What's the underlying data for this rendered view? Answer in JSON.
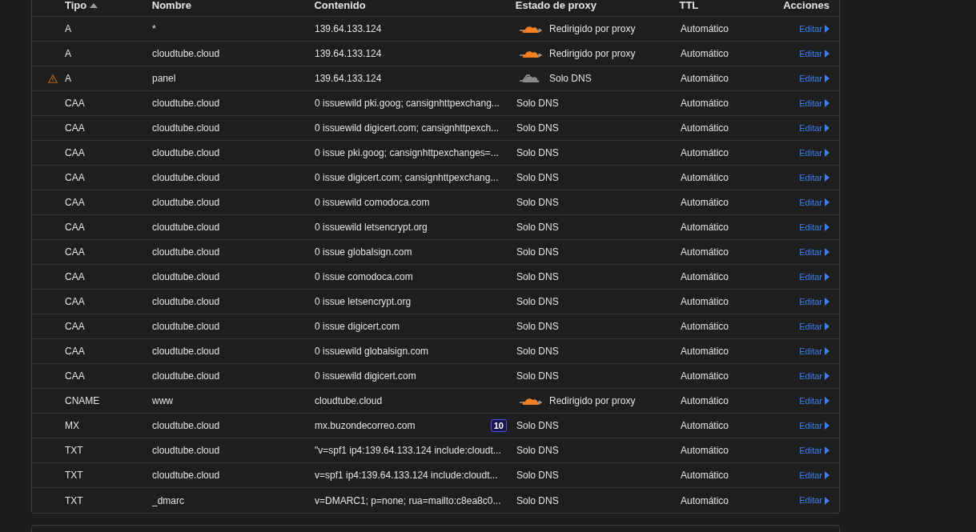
{
  "table": {
    "columns": [
      {
        "label": "Tipo",
        "sorted": true
      },
      {
        "label": "Nombre",
        "sorted": false
      },
      {
        "label": "Contenido",
        "sorted": false
      },
      {
        "label": "Estado de proxy",
        "sorted": false
      },
      {
        "label": "TTL",
        "sorted": false
      },
      {
        "label": "Acciones",
        "sorted": false
      }
    ],
    "rows": [
      {
        "warning": false,
        "type": "A",
        "name": "*",
        "content": "139.64.133.124",
        "proxy": {
          "kind": "proxied",
          "label": "Redirigido por proxy"
        },
        "ttl": "Automático",
        "action": "Editar"
      },
      {
        "warning": false,
        "type": "A",
        "name": "cloudtube.cloud",
        "content": "139.64.133.124",
        "proxy": {
          "kind": "proxied",
          "label": "Redirigido por proxy"
        },
        "ttl": "Automático",
        "action": "Editar"
      },
      {
        "warning": true,
        "type": "A",
        "name": "panel",
        "content": "139.64.133.124",
        "proxy": {
          "kind": "dns_only_icon",
          "label": "Solo DNS"
        },
        "ttl": "Automático",
        "action": "Editar"
      },
      {
        "warning": false,
        "type": "CAA",
        "name": "cloudtube.cloud",
        "content": "0 issuewild pki.goog; cansignhttpexchang...",
        "proxy": {
          "kind": "dns_only",
          "label": "Solo DNS"
        },
        "ttl": "Automático",
        "action": "Editar"
      },
      {
        "warning": false,
        "type": "CAA",
        "name": "cloudtube.cloud",
        "content": "0 issuewild digicert.com; cansignhttpexch...",
        "proxy": {
          "kind": "dns_only",
          "label": "Solo DNS"
        },
        "ttl": "Automático",
        "action": "Editar"
      },
      {
        "warning": false,
        "type": "CAA",
        "name": "cloudtube.cloud",
        "content": "0 issue pki.goog; cansignhttpexchanges=...",
        "proxy": {
          "kind": "dns_only",
          "label": "Solo DNS"
        },
        "ttl": "Automático",
        "action": "Editar"
      },
      {
        "warning": false,
        "type": "CAA",
        "name": "cloudtube.cloud",
        "content": "0 issue digicert.com; cansignhttpexchang...",
        "proxy": {
          "kind": "dns_only",
          "label": "Solo DNS"
        },
        "ttl": "Automático",
        "action": "Editar"
      },
      {
        "warning": false,
        "type": "CAA",
        "name": "cloudtube.cloud",
        "content": "0 issuewild comodoca.com",
        "proxy": {
          "kind": "dns_only",
          "label": "Solo DNS"
        },
        "ttl": "Automático",
        "action": "Editar"
      },
      {
        "warning": false,
        "type": "CAA",
        "name": "cloudtube.cloud",
        "content": "0 issuewild letsencrypt.org",
        "proxy": {
          "kind": "dns_only",
          "label": "Solo DNS"
        },
        "ttl": "Automático",
        "action": "Editar"
      },
      {
        "warning": false,
        "type": "CAA",
        "name": "cloudtube.cloud",
        "content": "0 issue globalsign.com",
        "proxy": {
          "kind": "dns_only",
          "label": "Solo DNS"
        },
        "ttl": "Automático",
        "action": "Editar"
      },
      {
        "warning": false,
        "type": "CAA",
        "name": "cloudtube.cloud",
        "content": "0 issue comodoca.com",
        "proxy": {
          "kind": "dns_only",
          "label": "Solo DNS"
        },
        "ttl": "Automático",
        "action": "Editar"
      },
      {
        "warning": false,
        "type": "CAA",
        "name": "cloudtube.cloud",
        "content": "0 issue letsencrypt.org",
        "proxy": {
          "kind": "dns_only",
          "label": "Solo DNS"
        },
        "ttl": "Automático",
        "action": "Editar"
      },
      {
        "warning": false,
        "type": "CAA",
        "name": "cloudtube.cloud",
        "content": "0 issue digicert.com",
        "proxy": {
          "kind": "dns_only",
          "label": "Solo DNS"
        },
        "ttl": "Automático",
        "action": "Editar"
      },
      {
        "warning": false,
        "type": "CAA",
        "name": "cloudtube.cloud",
        "content": "0 issuewild globalsign.com",
        "proxy": {
          "kind": "dns_only",
          "label": "Solo DNS"
        },
        "ttl": "Automático",
        "action": "Editar"
      },
      {
        "warning": false,
        "type": "CAA",
        "name": "cloudtube.cloud",
        "content": "0 issuewild digicert.com",
        "proxy": {
          "kind": "dns_only",
          "label": "Solo DNS"
        },
        "ttl": "Automático",
        "action": "Editar"
      },
      {
        "warning": false,
        "type": "CNAME",
        "name": "www",
        "content": "cloudtube.cloud",
        "proxy": {
          "kind": "proxied",
          "label": "Redirigido por proxy"
        },
        "ttl": "Automático",
        "action": "Editar"
      },
      {
        "warning": false,
        "type": "MX",
        "name": "cloudtube.cloud",
        "content": "mx.buzondecorreo.com",
        "priority": "10",
        "proxy": {
          "kind": "dns_only",
          "label": "Solo DNS"
        },
        "ttl": "Automático",
        "action": "Editar"
      },
      {
        "warning": false,
        "type": "TXT",
        "name": "cloudtube.cloud",
        "content": "\"v=spf1 ip4:139.64.133.124 include:cloudt...",
        "proxy": {
          "kind": "dns_only",
          "label": "Solo DNS"
        },
        "ttl": "Automático",
        "action": "Editar"
      },
      {
        "warning": false,
        "type": "TXT",
        "name": "cloudtube.cloud",
        "content": "v=spf1 ip4:139.64.133.124 include:cloudt...",
        "proxy": {
          "kind": "dns_only",
          "label": "Solo DNS"
        },
        "ttl": "Automático",
        "action": "Editar"
      },
      {
        "warning": false,
        "type": "TXT",
        "name": "_dmarc",
        "content": "v=DMARC1; p=none; rua=mailto:c8ea8c0...",
        "proxy": {
          "kind": "dns_only",
          "label": "Solo DNS"
        },
        "ttl": "Automático",
        "action": "Editar"
      }
    ]
  }
}
